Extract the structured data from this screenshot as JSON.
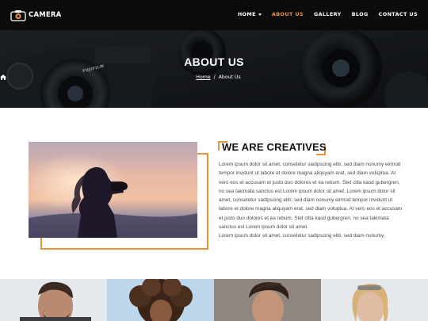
{
  "brand": {
    "name": "CAMERA"
  },
  "nav": {
    "items": [
      {
        "label": "HOME",
        "dropdown": true,
        "active": false
      },
      {
        "label": "ABOUT US",
        "dropdown": false,
        "active": true
      },
      {
        "label": "GALLERY",
        "dropdown": false,
        "active": false
      },
      {
        "label": "BLOG",
        "dropdown": false,
        "active": false
      },
      {
        "label": "CONTACT US",
        "dropdown": false,
        "active": false
      }
    ]
  },
  "hero": {
    "title": "ABOUT US",
    "breadcrumb": {
      "home": "Home",
      "separator": "/",
      "current": "About Us"
    },
    "camera_brand_text": "FUJIFILM"
  },
  "about": {
    "title": "WE ARE CREATIVES",
    "paragraphs": [
      "Lorem ipsum dolor sit amet, consetetur sadipscing elitr, sed diam nonumy eirmod tempor invidunt ut labore et dolore magna aliquyam erat, sed diam voluptua. At vero eos et accusam et justo duo dolores et ea rebum. Stet clita kasd gubergren, no sea takimata sanctus est Lorem ipsum dolor sit amet. Lorem ipsum dolor sit amet, consetetur sadipscing elitr, sed diam nonumy eirmod tempor invidunt ut labore et dolore magna aliquyam erat, sed diam voluptua. At vero eos et accusam et justo duo dolores et ea rebum. Stet clita kasd gubergren, no sea takimata sanctus est Lorem ipsum dolor sit amet.",
      "Lorem ipsum dolor sit amet, consetetur sadipscing elitr, sed diam nonumy."
    ]
  },
  "colors": {
    "accent": "#e8953d",
    "navbar_bg": "#0b0b0b",
    "text": "#4a4a4a",
    "heading": "#111111"
  },
  "icons": {
    "logo": "camera-icon",
    "breadcrumb_home": "home-icon",
    "dropdown": "chevron-down-icon"
  }
}
